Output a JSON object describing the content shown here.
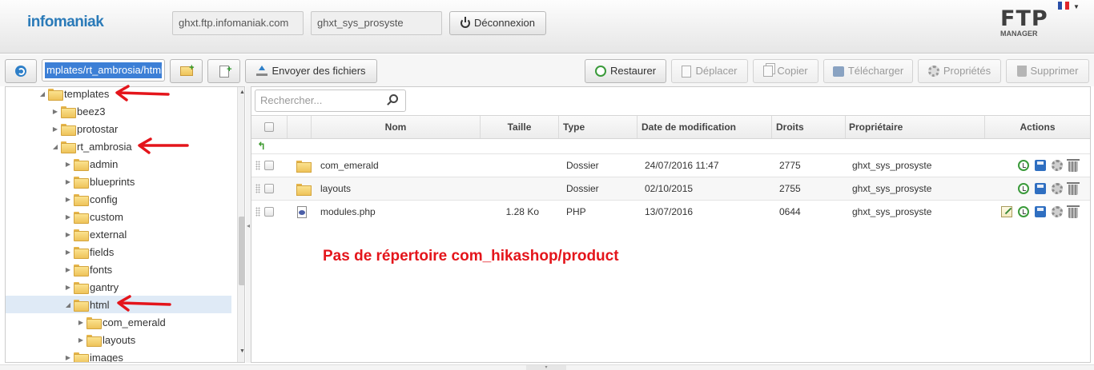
{
  "header": {
    "logo": "infomaniak",
    "host": "ghxt.ftp.infomaniak.com",
    "user": "ghxt_sys_prosyste",
    "logout_label": "Déconnexion",
    "app_logo_big": "FTP",
    "app_logo_small": "MANAGER",
    "language_flag": "fr-flag-icon"
  },
  "toolbar": {
    "path_value": "mplates/rt_ambrosia/html",
    "upload_label": "Envoyer des fichiers",
    "restore_label": "Restaurer",
    "move_label": "Déplacer",
    "copy_label": "Copier",
    "download_label": "Télécharger",
    "properties_label": "Propriétés",
    "delete_label": "Supprimer"
  },
  "tree": {
    "items": [
      {
        "label": "templates",
        "level": 0,
        "expanded": true
      },
      {
        "label": "beez3",
        "level": 1,
        "expanded": false
      },
      {
        "label": "protostar",
        "level": 1,
        "expanded": false
      },
      {
        "label": "rt_ambrosia",
        "level": 1,
        "expanded": true
      },
      {
        "label": "admin",
        "level": 2,
        "expanded": false
      },
      {
        "label": "blueprints",
        "level": 2,
        "expanded": false
      },
      {
        "label": "config",
        "level": 2,
        "expanded": false
      },
      {
        "label": "custom",
        "level": 2,
        "expanded": false
      },
      {
        "label": "external",
        "level": 2,
        "expanded": false
      },
      {
        "label": "fields",
        "level": 2,
        "expanded": false
      },
      {
        "label": "fonts",
        "level": 2,
        "expanded": false
      },
      {
        "label": "gantry",
        "level": 2,
        "expanded": false
      },
      {
        "label": "html",
        "level": 2,
        "expanded": true,
        "selected": true
      },
      {
        "label": "com_emerald",
        "level": 3,
        "expanded": false
      },
      {
        "label": "layouts",
        "level": 3,
        "expanded": false
      },
      {
        "label": "images",
        "level": 2,
        "expanded": false
      }
    ]
  },
  "search": {
    "placeholder": "Rechercher..."
  },
  "table": {
    "columns": [
      "Nom",
      "Taille",
      "Type",
      "Date de modification",
      "Droits",
      "Propriétaire",
      "Actions"
    ],
    "rows": [
      {
        "name": "com_emerald",
        "size": "",
        "type": "Dossier",
        "date": "24/07/2016 11:47",
        "rights": "2775",
        "owner": "ghxt_sys_prosyste",
        "icon": "folder-icon"
      },
      {
        "name": "layouts",
        "size": "",
        "type": "Dossier",
        "date": "02/10/2015",
        "rights": "2755",
        "owner": "ghxt_sys_prosyste",
        "icon": "folder-icon"
      },
      {
        "name": "modules.php",
        "size": "1.28 Ko",
        "type": "PHP",
        "date": "13/07/2016",
        "rights": "0644",
        "owner": "ghxt_sys_prosyste",
        "icon": "php-file-icon"
      }
    ]
  },
  "annotation": {
    "text": "Pas de répertoire com_hikashop/product",
    "color": "#e4151b"
  },
  "colors": {
    "accent": "#2a7ab8",
    "selection": "#3c7fd6",
    "arrow": "#e4151b"
  }
}
